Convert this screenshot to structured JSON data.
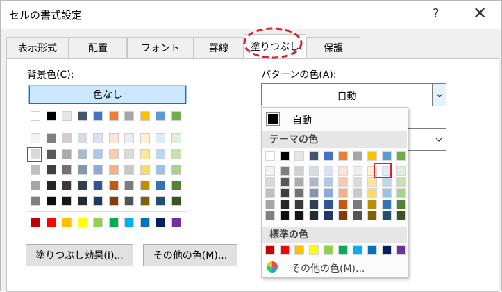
{
  "window": {
    "title": "セルの書式設定",
    "help_label": "?",
    "close_label": "✕"
  },
  "tabs": [
    "表示形式",
    "配置",
    "フォント",
    "罫線",
    "塗りつぶし",
    "保護"
  ],
  "active_tab": "塗りつぶし",
  "background": {
    "label_prefix": "背景色(",
    "label_key": "C",
    "label_suffix": "):",
    "no_color_label": "色なし",
    "basic_colors": [
      "#ffffff",
      "#000000",
      "#e7e6e6",
      "#44546a",
      "#4472c4",
      "#ed7d31",
      "#a5a5a5",
      "#ffc000",
      "#5b9bd5",
      "#70ad47"
    ],
    "tints": [
      [
        "#f2f2f2",
        "#7f7f7f",
        "#d0cece",
        "#d6dce4",
        "#d9e1f2",
        "#fce4d6",
        "#ededed",
        "#fff2cc",
        "#ddebf7",
        "#e2efda"
      ],
      [
        "#d9d9d9",
        "#595959",
        "#aeaaaa",
        "#acb9ca",
        "#b4c6e7",
        "#f8cbad",
        "#dbdbdb",
        "#ffe699",
        "#bdd7ee",
        "#c6e0b4"
      ],
      [
        "#bfbfbf",
        "#404040",
        "#757171",
        "#8497b0",
        "#8ea9db",
        "#f4b084",
        "#c9c9c9",
        "#ffd966",
        "#9bc2e6",
        "#a9d08e"
      ],
      [
        "#a6a6a6",
        "#262626",
        "#3a3838",
        "#333f4f",
        "#305496",
        "#c65911",
        "#7b7b7b",
        "#bf8f00",
        "#2f75b5",
        "#548235"
      ],
      [
        "#808080",
        "#0d0d0d",
        "#161616",
        "#222b35",
        "#203764",
        "#833c0c",
        "#525252",
        "#806000",
        "#1f4e78",
        "#375623"
      ]
    ],
    "standard_colors": [
      "#c00000",
      "#ff0000",
      "#ffc000",
      "#ffff00",
      "#92d050",
      "#00b050",
      "#00b0f0",
      "#0070c0",
      "#002060",
      "#7030a0"
    ],
    "fill_effects_label": "塗りつぶし効果(I)...",
    "more_colors_label": "その他の色(M)..."
  },
  "pattern": {
    "color_label": "パターンの色(A):",
    "color_value": "自動",
    "dropdown": {
      "auto_label": "自動",
      "theme_header": "テーマの色",
      "standard_header": "標準の色",
      "more_colors_label": "その他の色(M)..."
    }
  }
}
